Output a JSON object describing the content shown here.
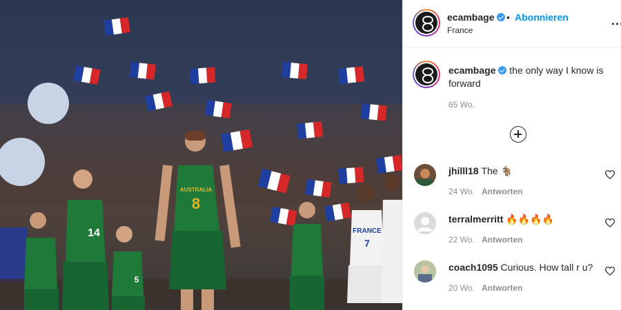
{
  "post": {
    "username": "ecambage",
    "follow_label": "Abonnieren",
    "location": "France",
    "more_label": "...",
    "separator": "•",
    "caption_username": "ecambage",
    "caption_text": "the only way I know is forward",
    "caption_time": "65 Wo."
  },
  "comments": [
    {
      "username": "jhilll18",
      "text": "The 🐐",
      "time": "24 Wo.",
      "reply_label": "Antworten",
      "avatar_color": "#6b4f3a"
    },
    {
      "username": "terralmerritt",
      "text": "🔥🔥🔥🔥",
      "time": "22 Wo.",
      "reply_label": "Antworten",
      "avatar_color": "#dbdbdb"
    },
    {
      "username": "coach1095",
      "text": "Curious. How tall r u?",
      "time": "20 Wo.",
      "reply_label": "Antworten",
      "avatar_color": "#8a9a6a"
    }
  ],
  "photo": {
    "jersey_8": "8",
    "jersey_14": "14",
    "jersey_5": "5",
    "jersey_7": "7",
    "team_left": "AUSTRALIA",
    "team_right": "FRANCE"
  },
  "colors": {
    "accent": "#0095f6",
    "verified": "#3897f0",
    "muted": "#8e8e8e",
    "green_jersey": "#1f7a3a",
    "gold_trim": "#e2b72b"
  }
}
